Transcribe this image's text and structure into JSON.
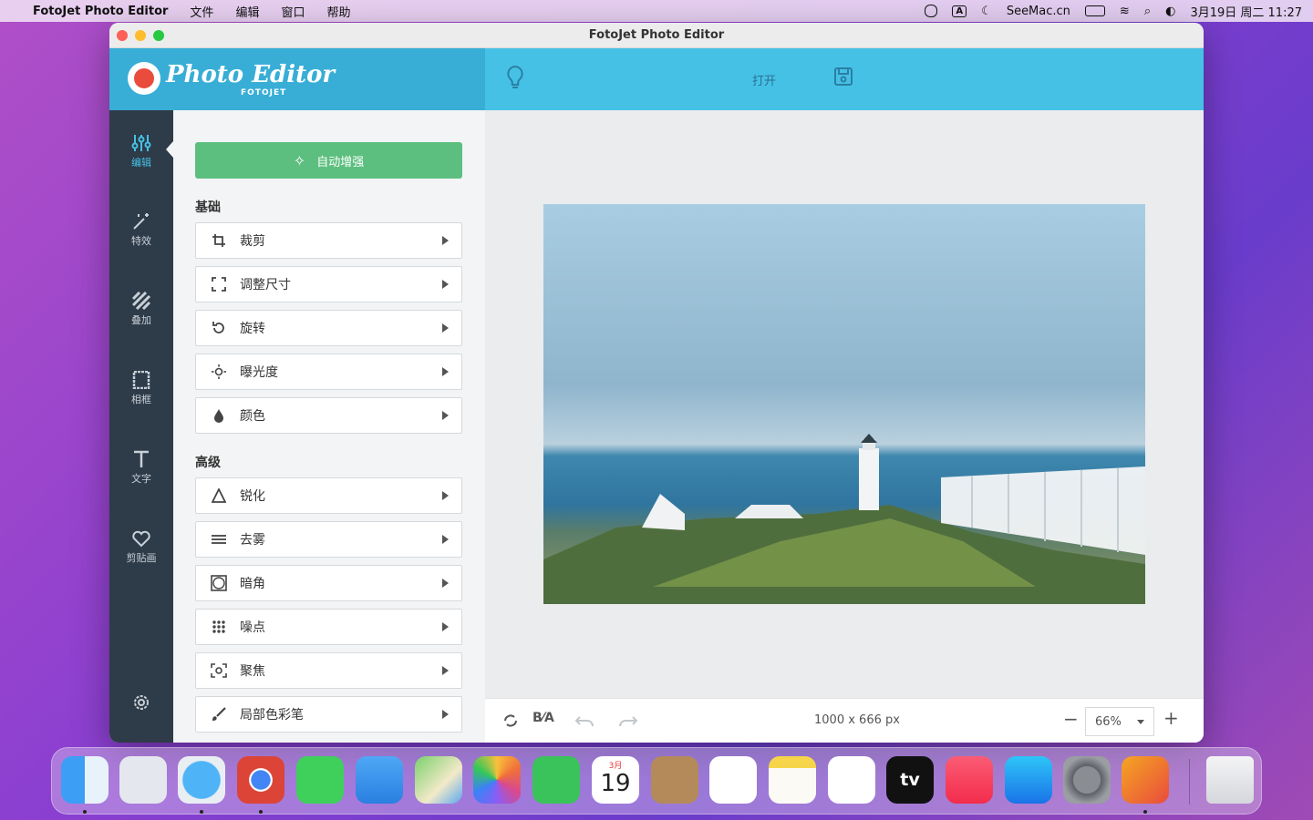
{
  "menubar": {
    "app_name": "FotoJet Photo Editor",
    "menus": [
      "文件",
      "编辑",
      "窗口",
      "帮助"
    ],
    "site": "SeeMac.cn",
    "input_method": "A",
    "datetime": "3月19日 周二  11:27"
  },
  "window": {
    "title": "FotoJet Photo Editor"
  },
  "brand": {
    "logo_text": "Photo Editor",
    "logo_sub": "FOTOJET"
  },
  "toolbar": {
    "open_label": "打开"
  },
  "nav": [
    {
      "label": "编辑",
      "icon": "sliders-icon"
    },
    {
      "label": "特效",
      "icon": "magic-wand-icon"
    },
    {
      "label": "叠加",
      "icon": "overlay-stripes-icon"
    },
    {
      "label": "相框",
      "icon": "frame-icon"
    },
    {
      "label": "文字",
      "icon": "text-icon"
    },
    {
      "label": "剪贴画",
      "icon": "heart-icon"
    }
  ],
  "panel": {
    "auto_enhance": "自动增强",
    "basic_title": "基础",
    "advanced_title": "高级",
    "basic": [
      {
        "label": "裁剪",
        "icon": "crop-icon"
      },
      {
        "label": "调整尺寸",
        "icon": "resize-icon"
      },
      {
        "label": "旋转",
        "icon": "rotate-icon"
      },
      {
        "label": "曝光度",
        "icon": "brightness-icon"
      },
      {
        "label": "颜色",
        "icon": "drop-icon"
      }
    ],
    "advanced": [
      {
        "label": "锐化",
        "icon": "triangle-icon"
      },
      {
        "label": "去雾",
        "icon": "haze-icon"
      },
      {
        "label": "暗角",
        "icon": "vignette-icon"
      },
      {
        "label": "噪点",
        "icon": "noise-icon"
      },
      {
        "label": "聚焦",
        "icon": "focus-icon"
      },
      {
        "label": "局部色彩笔",
        "icon": "brush-icon"
      }
    ]
  },
  "status": {
    "dimensions": "1000 x 666 px",
    "zoom": "66%"
  },
  "dock": {
    "calendar_month": "3月",
    "calendar_day": "19",
    "tv_label": "tv",
    "apps": [
      "Finder",
      "Launchpad",
      "Safari",
      "Chrome",
      "Messages",
      "Mail",
      "Maps",
      "Photos",
      "FaceTime",
      "Calendar",
      "Contacts",
      "Reminders",
      "Notes",
      "Freeform",
      "TV",
      "Music",
      "App Store",
      "System Preferences",
      "FotoJet Photo Editor",
      "Trash"
    ]
  },
  "colors": {
    "header": "#45c1e6",
    "brand": "#38aed6",
    "nav_bg": "#2e3b48",
    "accent_green": "#5dbf7f",
    "active": "#45c1e6"
  }
}
